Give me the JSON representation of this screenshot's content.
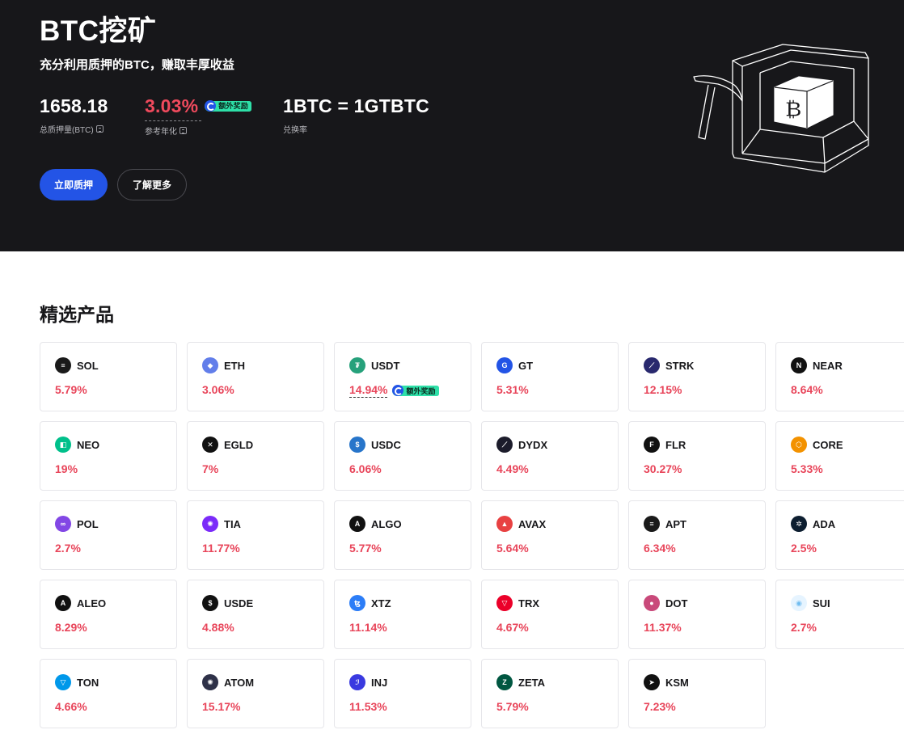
{
  "hero": {
    "title": "BTC挖矿",
    "subtitle": "充分利用质押的BTC，赚取丰厚收益",
    "stats": {
      "total_staked_value": "1658.18",
      "total_staked_label": "总质押量(BTC)",
      "apr_value": "3.03%",
      "apr_label": "参考年化",
      "bonus_label": "额外奖励",
      "rate_value": "1BTC = 1GTBTC",
      "rate_label": "兑换率"
    },
    "buttons": {
      "stake": "立即质押",
      "learn_more": "了解更多"
    },
    "colors": {
      "background": "#17171a",
      "accent": "#2354e6",
      "apr": "#f04a5d"
    }
  },
  "products": {
    "title": "精选产品",
    "bonus_label": "额外奖励",
    "items": [
      {
        "name": "SOL",
        "rate": "5.79%",
        "icon": "sol-icon",
        "color": "#1a1a1a"
      },
      {
        "name": "ETH",
        "rate": "3.06%",
        "icon": "eth-icon",
        "color": "#627eea"
      },
      {
        "name": "USDT",
        "rate": "14.94%",
        "icon": "usdt-icon",
        "color": "#26a17b",
        "bonus": true
      },
      {
        "name": "GT",
        "rate": "5.31%",
        "icon": "gt-icon",
        "color": "#2354e6"
      },
      {
        "name": "STRK",
        "rate": "12.15%",
        "icon": "strk-icon",
        "color": "#29296e"
      },
      {
        "name": "NEAR",
        "rate": "8.64%",
        "icon": "near-icon",
        "color": "#111111"
      },
      {
        "name": "NEO",
        "rate": "19%",
        "icon": "neo-icon",
        "color": "#00c08b"
      },
      {
        "name": "EGLD",
        "rate": "7%",
        "icon": "egld-icon",
        "color": "#111111"
      },
      {
        "name": "USDC",
        "rate": "6.06%",
        "icon": "usdc-icon",
        "color": "#2775ca"
      },
      {
        "name": "DYDX",
        "rate": "4.49%",
        "icon": "dydx-icon",
        "color": "#1c1c2b"
      },
      {
        "name": "FLR",
        "rate": "30.27%",
        "icon": "flr-icon",
        "color": "#111111"
      },
      {
        "name": "CORE",
        "rate": "5.33%",
        "icon": "core-icon",
        "color": "#f39200"
      },
      {
        "name": "POL",
        "rate": "2.7%",
        "icon": "pol-icon",
        "color": "#8247e5"
      },
      {
        "name": "TIA",
        "rate": "11.77%",
        "icon": "tia-icon",
        "color": "#7b2bf9"
      },
      {
        "name": "ALGO",
        "rate": "5.77%",
        "icon": "algo-icon",
        "color": "#111111"
      },
      {
        "name": "AVAX",
        "rate": "5.64%",
        "icon": "avax-icon",
        "color": "#e84142"
      },
      {
        "name": "APT",
        "rate": "6.34%",
        "icon": "apt-icon",
        "color": "#1a1a1a"
      },
      {
        "name": "ADA",
        "rate": "2.5%",
        "icon": "ada-icon",
        "color": "#0d1e30"
      },
      {
        "name": "ALEO",
        "rate": "8.29%",
        "icon": "aleo-icon",
        "color": "#111111"
      },
      {
        "name": "USDE",
        "rate": "4.88%",
        "icon": "usde-icon",
        "color": "#111111"
      },
      {
        "name": "XTZ",
        "rate": "11.14%",
        "icon": "xtz-icon",
        "color": "#2c7df7"
      },
      {
        "name": "TRX",
        "rate": "4.67%",
        "icon": "trx-icon",
        "color": "#eb0029"
      },
      {
        "name": "DOT",
        "rate": "11.37%",
        "icon": "dot-icon",
        "color": "#c9497a"
      },
      {
        "name": "SUI",
        "rate": "2.7%",
        "icon": "sui-icon",
        "color": "#6fbcf0"
      },
      {
        "name": "TON",
        "rate": "4.66%",
        "icon": "ton-icon",
        "color": "#0098ea"
      },
      {
        "name": "ATOM",
        "rate": "15.17%",
        "icon": "atom-icon",
        "color": "#2e3148"
      },
      {
        "name": "INJ",
        "rate": "11.53%",
        "icon": "inj-icon",
        "color": "#3a3ae0"
      },
      {
        "name": "ZETA",
        "rate": "5.79%",
        "icon": "zeta-icon",
        "color": "#005741"
      },
      {
        "name": "KSM",
        "rate": "7.23%",
        "icon": "ksm-icon",
        "color": "#111111"
      }
    ]
  }
}
